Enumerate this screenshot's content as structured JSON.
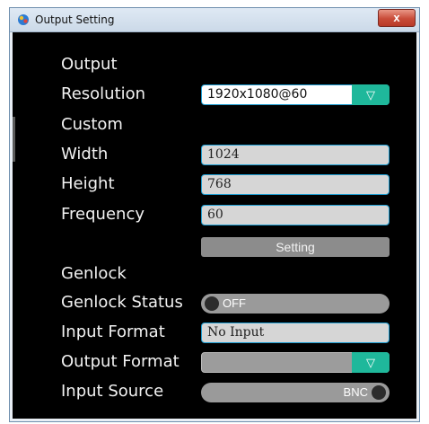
{
  "window": {
    "title": "Output Setting",
    "close_glyph": "x",
    "app_icon": "app-icon"
  },
  "labels": {
    "output": "Output",
    "resolution": "Resolution",
    "custom": "Custom",
    "width": "Width",
    "height": "Height",
    "frequency": "Frequency",
    "genlock": "Genlock",
    "genlock_status": "Genlock Status",
    "input_format": "Input Format",
    "output_format": "Output Format",
    "input_source": "Input Source"
  },
  "values": {
    "resolution": "1920x1080@60",
    "width": "1024",
    "height": "768",
    "frequency": "60",
    "input_format": "No Input",
    "output_format": "",
    "genlock_status": "OFF",
    "input_source": "BNC"
  },
  "buttons": {
    "setting": "Setting",
    "dropdown_glyph": "▽"
  },
  "colors": {
    "accent": "#1fb89b",
    "field_border": "#1d9cd0",
    "background": "#000000"
  }
}
